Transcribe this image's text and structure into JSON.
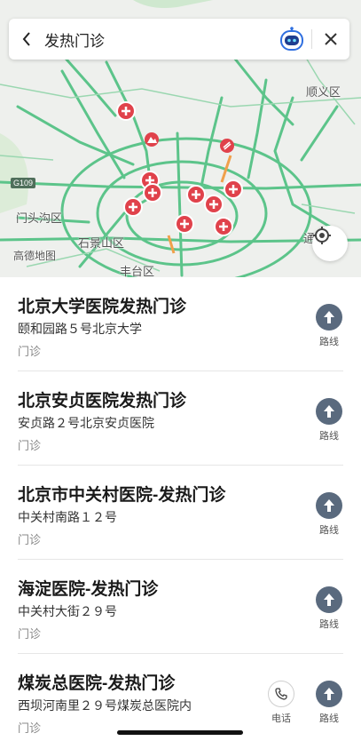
{
  "search": {
    "query": "发热门诊"
  },
  "map": {
    "labels": [
      "顺义区",
      "门头沟区",
      "石景山区",
      "高德地图",
      "丰台区",
      "G109",
      "通"
    ],
    "marker_color": "#e0424b",
    "road_color": "#5cc48a"
  },
  "results": [
    {
      "name": "北京大学医院发热门诊",
      "address": "颐和园路５号北京大学",
      "category": "门诊",
      "route_label": "路线"
    },
    {
      "name": "北京安贞医院发热门诊",
      "address": "安贞路２号北京安贞医院",
      "category": "门诊",
      "route_label": "路线"
    },
    {
      "name": "北京市中关村医院-发热门诊",
      "address": "中关村南路１２号",
      "category": "门诊",
      "route_label": "路线"
    },
    {
      "name": "海淀医院-发热门诊",
      "address": "中关村大街２９号",
      "category": "门诊",
      "route_label": "路线"
    },
    {
      "name": "煤炭总医院-发热门诊",
      "address": "西坝河南里２９号煤炭总医院内",
      "category": "门诊",
      "route_label": "路线",
      "phone_label": "电话"
    }
  ],
  "icons": [
    "back-arrow-icon",
    "assistant-robot-icon",
    "close-icon",
    "locate-icon",
    "route-arrow-icon",
    "phone-icon",
    "hospital-marker-icon"
  ]
}
